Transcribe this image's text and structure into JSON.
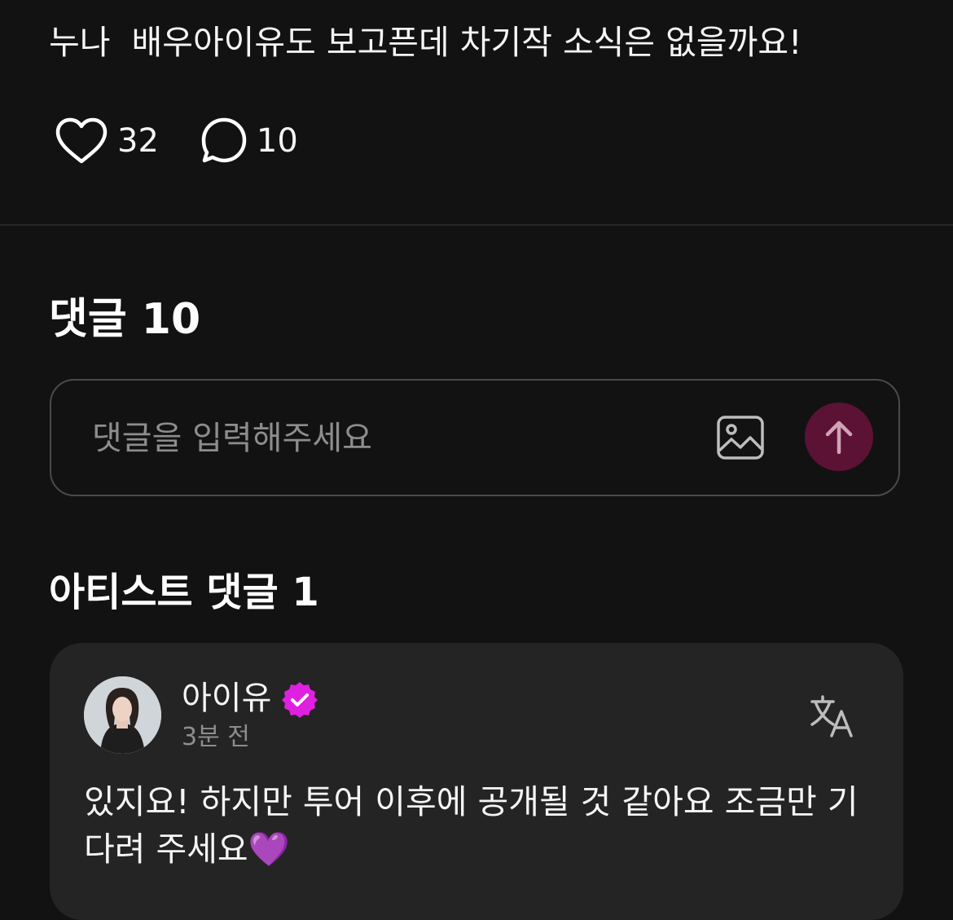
{
  "post": {
    "text": "누나  배우아이유도 보고픈데 차기작 소식은 없을까요!",
    "like_count": "32",
    "comment_count": "10"
  },
  "comments_section": {
    "title": "댓글 10",
    "input_placeholder": "댓글을 입력해주세요",
    "input_value": ""
  },
  "artist_section": {
    "title": "아티스트 댓글 1",
    "comment": {
      "author": "아이유",
      "time": "3분 전",
      "text": "있지요! 하지만 투어 이후에 공개될 것 같아요 조금만 기\n다려 주세요💜"
    }
  },
  "icons": {
    "like": "heart-outline-icon",
    "comment": "speech-bubble-icon",
    "image": "image-icon",
    "send": "arrow-up-icon",
    "verified": "verified-badge-icon",
    "translate": "translate-icon"
  },
  "colors": {
    "background": "#121212",
    "card": "#242424",
    "send_button": "#5b1234",
    "verified_badge": "#e020e0",
    "muted_text": "#8d8d8d"
  }
}
